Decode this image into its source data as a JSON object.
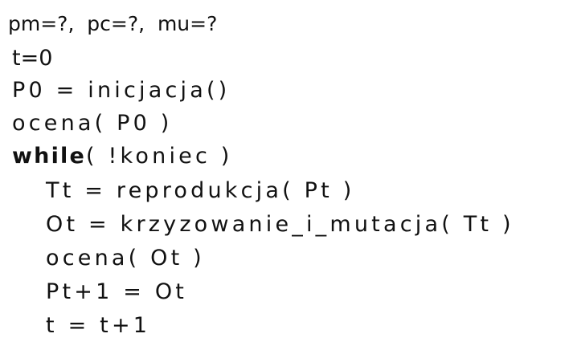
{
  "lines": {
    "params": "pm=?,  pc=?,  mu=?",
    "t_init": "t=0",
    "p0_init": "P0 = inicjacja()",
    "ocena_p0": "ocena( P0 )",
    "while_keyword": "while",
    "while_condition": "( !koniec )",
    "reproduction": "Tt = reprodukcja( Pt )",
    "crossover_mutation": "Ot = krzyzowanie_i_mutacja( Tt )",
    "ocena_ot": "ocena( Ot )",
    "next_population": "Pt+1 = Ot",
    "increment": "t = t+1"
  }
}
